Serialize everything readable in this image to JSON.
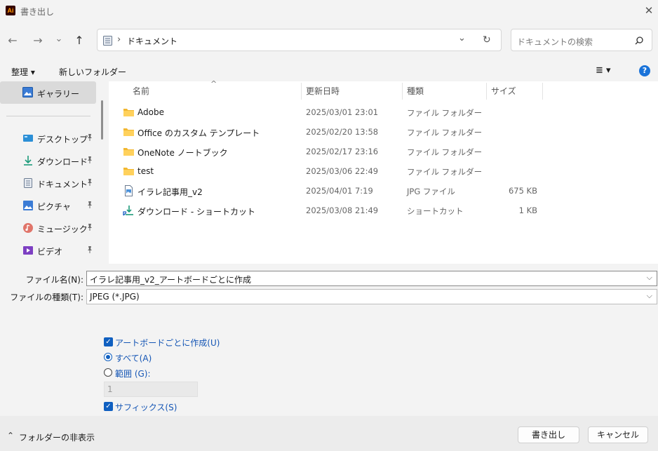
{
  "window": {
    "title": "書き出し",
    "app_icon_text": "Ai",
    "close_glyph": "✕"
  },
  "nav": {
    "back_glyph": "←",
    "forward_glyph": "→",
    "recent_glyph": "⌄",
    "up_glyph": "↑",
    "address_separator": "›",
    "address_path": "ドキュメント",
    "address_dropdown_glyph": "⌄",
    "refresh_glyph": "↻",
    "search_placeholder": "ドキュメントの検索"
  },
  "commands": {
    "organize": "整理 ▾",
    "new_folder": "新しいフォルダー",
    "view_glyph": "≣ ▾",
    "help_glyph": "?"
  },
  "sidebar": {
    "gallery": "ギャラリー",
    "items": [
      {
        "label": "デスクトップ",
        "icon": "desktop-icon",
        "pin": "pin-icon"
      },
      {
        "label": "ダウンロード",
        "icon": "download-icon",
        "pin": "pin-icon"
      },
      {
        "label": "ドキュメント",
        "icon": "document-icon",
        "pin": "pin-icon"
      },
      {
        "label": "ピクチャ",
        "icon": "pictures-icon",
        "pin": "pin-icon"
      },
      {
        "label": "ミュージック",
        "icon": "music-icon",
        "pin": "pin-icon"
      },
      {
        "label": "ビデオ",
        "icon": "video-icon",
        "pin": "pin-icon"
      }
    ]
  },
  "file_list": {
    "sort_glyph": "^",
    "columns": {
      "name": "名前",
      "modified": "更新日時",
      "type": "種類",
      "size": "サイズ"
    },
    "rows": [
      {
        "name": "Adobe",
        "modified": "2025/03/01 23:01",
        "type": "ファイル フォルダー",
        "size": "",
        "icon": "folder-icon"
      },
      {
        "name": "Office のカスタム テンプレート",
        "modified": "2025/02/20 13:58",
        "type": "ファイル フォルダー",
        "size": "",
        "icon": "folder-icon"
      },
      {
        "name": "OneNote ノートブック",
        "modified": "2025/02/17 23:16",
        "type": "ファイル フォルダー",
        "size": "",
        "icon": "folder-icon"
      },
      {
        "name": "test",
        "modified": "2025/03/06 22:49",
        "type": "ファイル フォルダー",
        "size": "",
        "icon": "folder-icon"
      },
      {
        "name": "イラレ記事用_v2",
        "modified": "2025/04/01 7:19",
        "type": "JPG ファイル",
        "size": "675 KB",
        "icon": "image-file-icon"
      },
      {
        "name": "ダウンロード - ショートカット",
        "modified": "2025/03/08 21:49",
        "type": "ショートカット",
        "size": "1 KB",
        "icon": "shortcut-icon"
      }
    ]
  },
  "form": {
    "filename_label": "ファイル名(N):",
    "filename_value": "イラレ記事用_v2_アートボードごとに作成",
    "filetype_label": "ファイルの種類(T):",
    "filetype_value": "JPEG (*.JPG)",
    "dropdown_glyph": "⌵"
  },
  "options": {
    "per_artboard": "アートボードごとに作成(U)",
    "all": "すべて(A)",
    "range": "範囲 (G):",
    "range_value": "1",
    "suffix": "サフィックス(S)",
    "check_glyph": "✓"
  },
  "footer": {
    "hide_folders": "フォルダーの非表示",
    "hide_glyph": "⌃",
    "export_button": "書き出し",
    "cancel_button": "キャンセル"
  }
}
